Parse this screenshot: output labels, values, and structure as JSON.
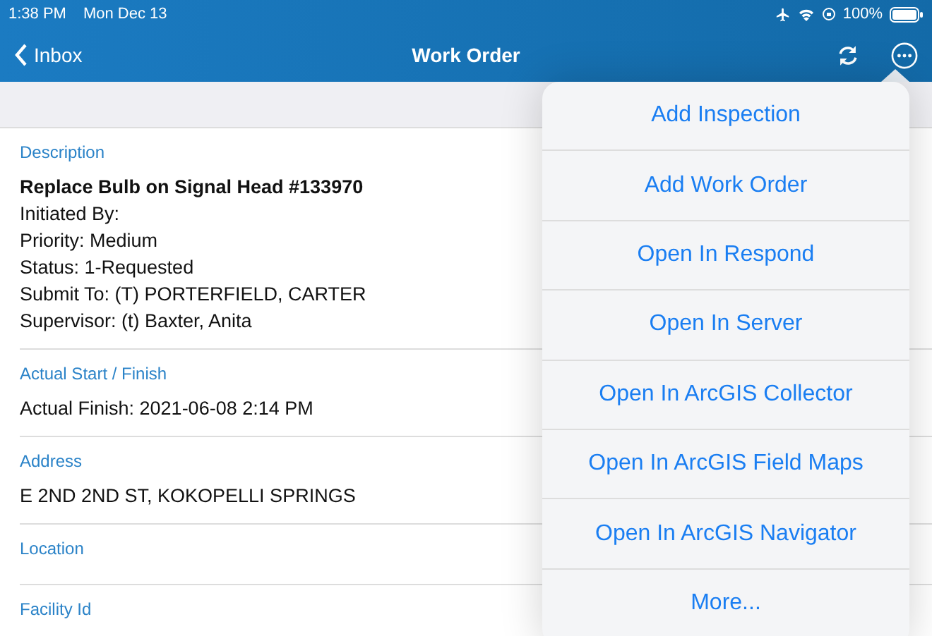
{
  "status_bar": {
    "time": "1:38 PM",
    "date": "Mon Dec 13",
    "battery": "100%"
  },
  "nav": {
    "back": "Inbox",
    "title": "Work Order"
  },
  "sections": [
    {
      "label": "Description",
      "title": "Replace Bulb on Signal Head #133970",
      "lines": [
        "Initiated By:",
        "Priority: Medium",
        "Status: 1-Requested",
        "Submit To: (T) PORTERFIELD, CARTER",
        "Supervisor: (t) Baxter, Anita"
      ]
    },
    {
      "label": "Actual Start / Finish",
      "lines": [
        "Actual Finish: 2021-06-08 2:14 PM"
      ]
    },
    {
      "label": "Address",
      "lines": [
        "E 2ND 2ND ST, KOKOPELLI SPRINGS"
      ]
    },
    {
      "label": "Location"
    },
    {
      "label": "Facility Id"
    }
  ],
  "menu": [
    "Add Inspection",
    "Add Work Order",
    "Open In Respond",
    "Open In Server",
    "Open In ArcGIS Collector",
    "Open In ArcGIS Field Maps",
    "Open In ArcGIS Navigator",
    "More..."
  ]
}
